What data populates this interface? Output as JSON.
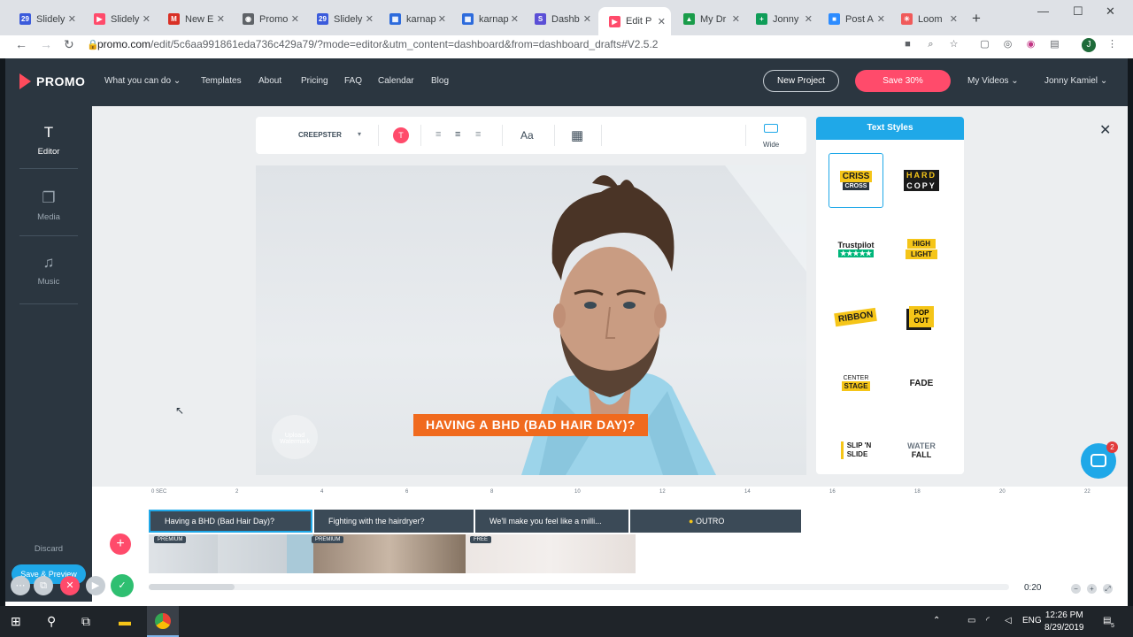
{
  "browser": {
    "tabs": [
      {
        "title": "Slidely",
        "fav_color": "#3b5bdb",
        "fav_glyph": "29"
      },
      {
        "title": "Slidely",
        "fav_color": "#ff4b6b",
        "fav_glyph": "▶"
      },
      {
        "title": "New E",
        "fav_color": "#d93025",
        "fav_glyph": "M"
      },
      {
        "title": "Promo",
        "fav_color": "#5f6368",
        "fav_glyph": "◉"
      },
      {
        "title": "Slidely",
        "fav_color": "#3b5bdb",
        "fav_glyph": "29"
      },
      {
        "title": "karnap",
        "fav_color": "#2d6bdc",
        "fav_glyph": "▦"
      },
      {
        "title": "karnap",
        "fav_color": "#2d6bdc",
        "fav_glyph": "▦"
      },
      {
        "title": "Dashb",
        "fav_color": "#5b4fd6",
        "fav_glyph": "S"
      },
      {
        "title": "Edit P",
        "fav_color": "#ff4b6b",
        "fav_glyph": "▶"
      },
      {
        "title": "My Dr",
        "fav_color": "#1a9c4a",
        "fav_glyph": "▲"
      },
      {
        "title": "Jonny",
        "fav_color": "#0f9d58",
        "fav_glyph": "+"
      },
      {
        "title": "Post A",
        "fav_color": "#2d8cff",
        "fav_glyph": "■"
      },
      {
        "title": "Loom",
        "fav_color": "#f05a5a",
        "fav_glyph": "✳"
      }
    ],
    "url_host": "promo.com",
    "url_path": "/edit/5c6aa991861eda736c429a79/?mode=editor&utm_content=dashboard&from=dashboard_drafts#V2.5.2",
    "profile_initial": "J"
  },
  "nav": {
    "logo": "PROMO",
    "links": [
      "What you can do",
      "Templates",
      "About",
      "Pricing",
      "FAQ",
      "Calendar",
      "Blog"
    ],
    "new_project": "New Project",
    "save": "Save 30%",
    "my_videos": "My Videos",
    "user": "Jonny Kamiel"
  },
  "sidebar": {
    "items": [
      {
        "label": "Editor",
        "icon": "text-T-icon"
      },
      {
        "label": "Media",
        "icon": "media-icon"
      },
      {
        "label": "Music",
        "icon": "music-note-icon"
      }
    ],
    "discard": "Discard",
    "save_preview": "Save & Preview"
  },
  "toolbar": {
    "font_name": "CREEPSTER",
    "color_letter": "T",
    "case_label": "Aa",
    "ratio_label": "Wide"
  },
  "canvas": {
    "caption": "HAVING A BHD (BAD HAIR DAY)?",
    "watermark": "Upload Watermark"
  },
  "text_styles": {
    "title": "Text Styles",
    "items": [
      {
        "name": "CRISS CROSS",
        "l1": "CRISS",
        "l2": "CROSS"
      },
      {
        "name": "HARD COPY",
        "l1": "HARD",
        "l2": "COPY"
      },
      {
        "name": "Trustpilot",
        "l1": "Trustpilot",
        "l2": "★★★★★"
      },
      {
        "name": "HIGH LIGHT",
        "l1": "HIGH",
        "l2": "LIGHT"
      },
      {
        "name": "RIBBON",
        "l1": "RIBBON",
        "l2": ""
      },
      {
        "name": "POP OUT",
        "l1": "POP",
        "l2": "OUT"
      },
      {
        "name": "CENTER STAGE",
        "l1": "CENTER",
        "l2": "STAGE"
      },
      {
        "name": "FADE",
        "l1": "FADE",
        "l2": ""
      },
      {
        "name": "SLIP 'N SLIDE",
        "l1": "SLIP 'N",
        "l2": "SLIDE"
      },
      {
        "name": "WATER FALL",
        "l1": "WATER",
        "l2": "FALL"
      }
    ]
  },
  "timeline": {
    "ticks": [
      "0 SEC",
      "2",
      "4",
      "6",
      "8",
      "10",
      "12",
      "14",
      "16",
      "18",
      "20",
      "22"
    ],
    "segments": [
      "Having a BHD (Bad Hair Day)?",
      "Fighting with the hairdryer?",
      "We'll make you feel like a milli...",
      "OUTRO"
    ],
    "badges": [
      "PREMIUM",
      "PREMIUM",
      "FREE"
    ],
    "duration": "0:20"
  },
  "chat": {
    "count": "2"
  },
  "taskbar": {
    "lang": "ENG",
    "time": "12:26 PM",
    "date": "8/29/2019",
    "notif": "5"
  }
}
